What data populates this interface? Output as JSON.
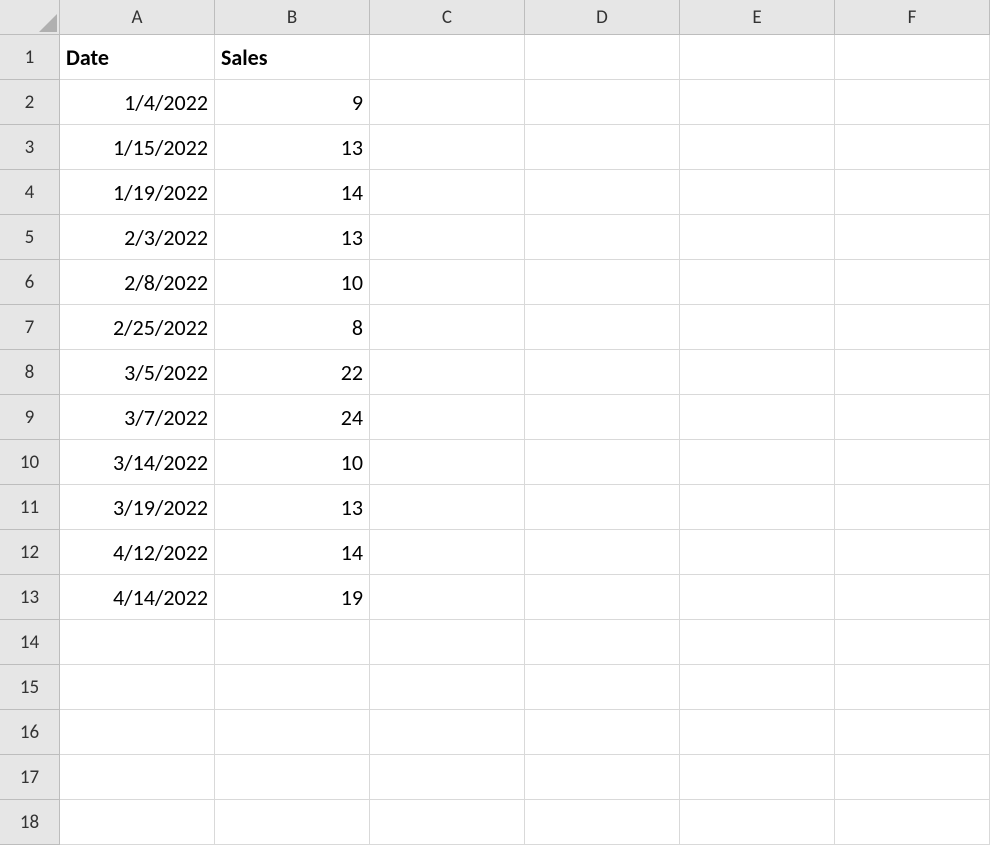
{
  "columns": [
    "A",
    "B",
    "C",
    "D",
    "E",
    "F"
  ],
  "rowCount": 18,
  "headers": {
    "A": "Date",
    "B": "Sales"
  },
  "data": {
    "rows": [
      {
        "date": "1/4/2022",
        "sales": "9"
      },
      {
        "date": "1/15/2022",
        "sales": "13"
      },
      {
        "date": "1/19/2022",
        "sales": "14"
      },
      {
        "date": "2/3/2022",
        "sales": "13"
      },
      {
        "date": "2/8/2022",
        "sales": "10"
      },
      {
        "date": "2/25/2022",
        "sales": "8"
      },
      {
        "date": "3/5/2022",
        "sales": "22"
      },
      {
        "date": "3/7/2022",
        "sales": "24"
      },
      {
        "date": "3/14/2022",
        "sales": "10"
      },
      {
        "date": "3/19/2022",
        "sales": "13"
      },
      {
        "date": "4/12/2022",
        "sales": "14"
      },
      {
        "date": "4/14/2022",
        "sales": "19"
      }
    ]
  }
}
